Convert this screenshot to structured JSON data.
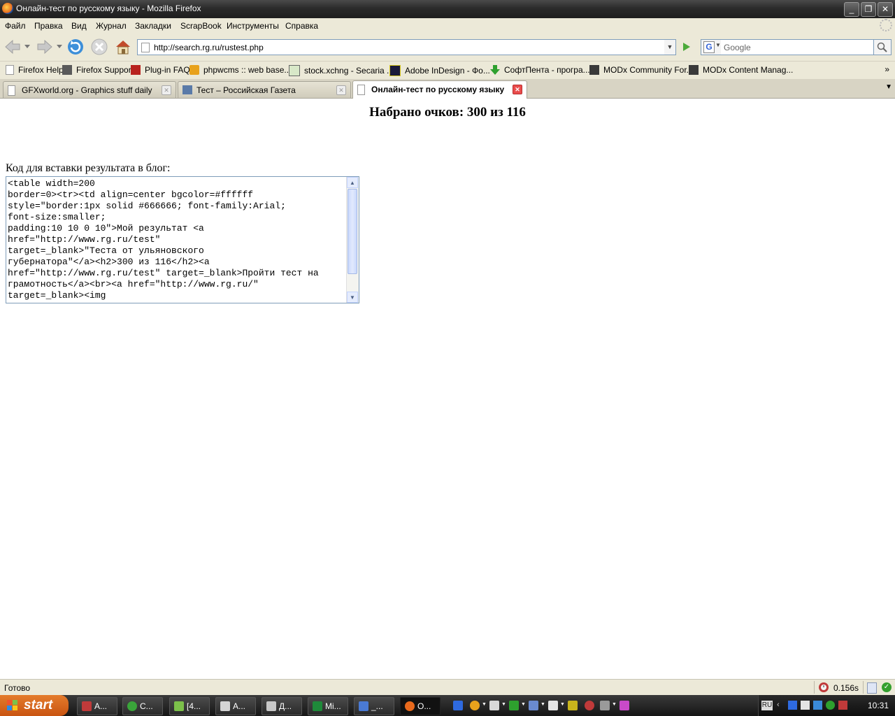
{
  "window": {
    "title": "Онлайн-тест по русскому языку - Mozilla Firefox",
    "buttons": {
      "minimize": "_",
      "maximize": "❐",
      "close": "✕"
    }
  },
  "menu": [
    "Файл",
    "Правка",
    "Вид",
    "Журнал",
    "Закладки",
    "ScrapBook",
    "Инструменты",
    "Справка"
  ],
  "nav": {
    "url": "http://search.rg.ru/rustest.php",
    "search_placeholder": "Google",
    "search_engine_glyph": "G"
  },
  "bookmarks": [
    {
      "label": "Firefox Help",
      "icon": "page-icon"
    },
    {
      "label": "Firefox Support",
      "icon": "zine-icon"
    },
    {
      "label": "Plug-in FAQ",
      "icon": "plugin-icon"
    },
    {
      "label": "phpwcms :: web base...",
      "icon": "phpwcms-icon"
    },
    {
      "label": "stock.xchng - Secaria ...",
      "icon": "sxc-icon"
    },
    {
      "label": "Adobe InDesign - Фо...",
      "icon": "indesign-icon"
    },
    {
      "label": "СофтПента - програ...",
      "icon": "download-arrow-icon"
    },
    {
      "label": "MODx Community For...",
      "icon": "modx-icon"
    },
    {
      "label": "MODx Content Manag...",
      "icon": "modx-icon"
    }
  ],
  "bookmarks_more": "»",
  "tabs": [
    {
      "label": "GFXworld.org - Graphics stuff daily",
      "active": false
    },
    {
      "label": "Тест – Российская Газета",
      "active": false
    },
    {
      "label": "Онлайн-тест по русскому языку",
      "active": true
    }
  ],
  "tab_close_glyph": "✕",
  "tab_list_glyph": "▼",
  "page": {
    "score_text": "Набрано очков: 300 из 116",
    "embed_label": "Код для вставки результата в блог:",
    "embed_code": "<table width=200\nborder=0><tr><td align=center bgcolor=#ffffff\nstyle=\"border:1px solid #666666; font-family:Arial;\nfont-size:smaller;\npadding:10 10 0 10\">Мой результат <a\nhref=\"http://www.rg.ru/test\"\ntarget=_blank>\"Теста от ульяновского\nгубернатора\"</a><h2>300 из 116</h2><a\nhref=\"http://www.rg.ru/test\" target=_blank>Пройти тест на\nграмотность</a><br><a href=\"http://www.rg.ru/\"\ntarget=_blank><img"
  },
  "status": {
    "text": "Готово",
    "timer": "0.156s"
  },
  "taskbar": {
    "start_label": "start",
    "tasks": [
      {
        "label": "A...",
        "color": "#c03a3a",
        "active": false
      },
      {
        "label": "C...",
        "color": "#3aa43a",
        "active": false
      },
      {
        "label": "[4...",
        "color": "#7cc04a",
        "active": false
      },
      {
        "label": "A...",
        "color": "#d4d4d4",
        "active": false
      },
      {
        "label": "Д...",
        "color": "#c8c8c8",
        "active": false
      },
      {
        "label": "Mi...",
        "color": "#1f8a3a",
        "active": false
      },
      {
        "label": "_...",
        "color": "#4a7ad4",
        "active": false
      },
      {
        "label": "O...",
        "color": "#e8691c",
        "active": true
      }
    ],
    "tray": {
      "lang": "RU",
      "clock": "10:31"
    }
  },
  "colors": {
    "titlebar": "#2b2b2b",
    "chrome": "#ece9d8",
    "start_button": "#d65f17",
    "active_tab_close": "#e94c4c"
  }
}
